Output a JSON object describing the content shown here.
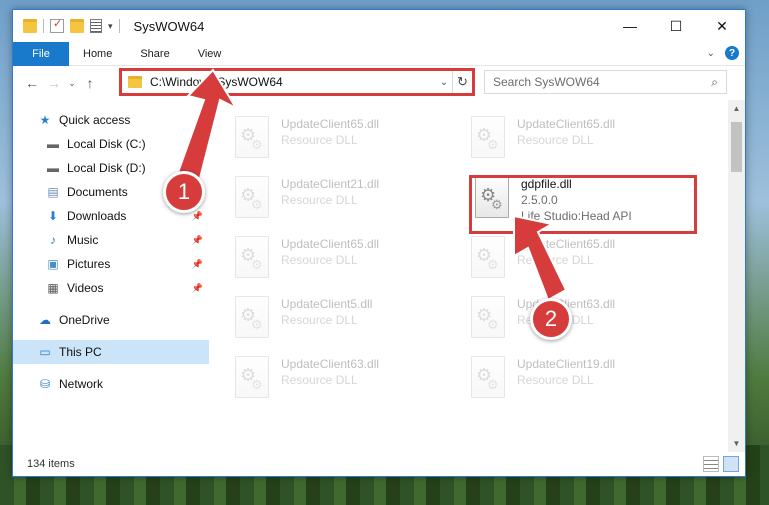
{
  "window": {
    "title": "SysWOW64",
    "controls": {
      "minimize": "—",
      "maximize": "☐",
      "close": "✕"
    }
  },
  "ribbon": {
    "tabs": [
      "File",
      "Home",
      "Share",
      "View"
    ]
  },
  "navigation": {
    "address_path": "C:\\Windows\\SysWOW64",
    "search_placeholder": "Search SysWOW64"
  },
  "sidebar": {
    "items": [
      {
        "label": "Quick access",
        "icon": "star-icon"
      },
      {
        "label": "Local Disk (C:)",
        "icon": "drive-icon"
      },
      {
        "label": "Local Disk (D:)",
        "icon": "drive-icon"
      },
      {
        "label": "Documents",
        "icon": "documents-icon"
      },
      {
        "label": "Downloads",
        "icon": "download-icon"
      },
      {
        "label": "Music",
        "icon": "music-icon"
      },
      {
        "label": "Pictures",
        "icon": "pictures-icon"
      },
      {
        "label": "Videos",
        "icon": "videos-icon"
      },
      {
        "label": "OneDrive",
        "icon": "cloud-icon"
      },
      {
        "label": "This PC",
        "icon": "computer-icon"
      },
      {
        "label": "Network",
        "icon": "network-icon"
      }
    ]
  },
  "files": [
    {
      "name": "UpdateClient65.dll",
      "type": "Resource DLL"
    },
    {
      "name": "UpdateClient65.dll",
      "type": "Resource DLL"
    },
    {
      "name": "UpdateClient21.dll",
      "type": "Resource DLL"
    },
    {
      "name": "gdpfile.dll",
      "version": "2.5.0.0",
      "description": "Life Studio:Head API"
    },
    {
      "name": "UpdateClient65.dll",
      "type": "Resource DLL"
    },
    {
      "name": "UpdateClient65.dll",
      "type": "Resource DLL"
    },
    {
      "name": "UpdateClient5.dll",
      "type": "Resource DLL"
    },
    {
      "name": "UpdateClient63.dll",
      "type": "Resource DLL"
    },
    {
      "name": "UpdateClient63.dll",
      "type": "Resource DLL"
    },
    {
      "name": "UpdateClient19.dll",
      "type": "Resource DLL"
    }
  ],
  "status": {
    "item_count": "134 items"
  },
  "callouts": [
    "1",
    "2"
  ],
  "colors": {
    "accent": "#1979ca",
    "highlight": "#d63c3c",
    "selected": "#cce4f7"
  }
}
